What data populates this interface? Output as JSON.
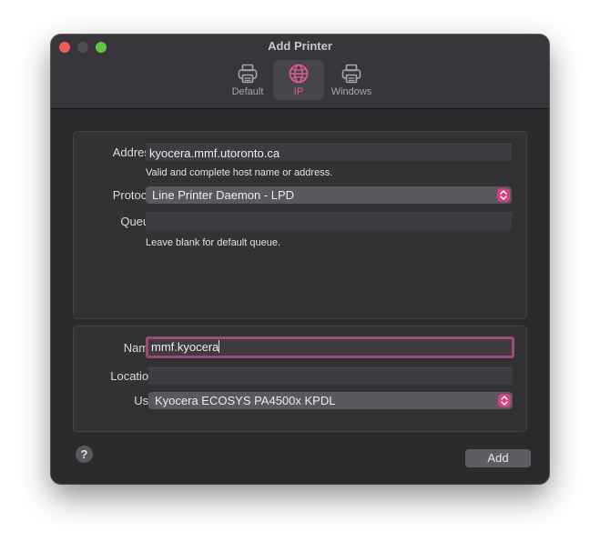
{
  "window": {
    "title": "Add Printer"
  },
  "tabs": [
    {
      "label": "Default",
      "icon": "printer-icon",
      "active": false
    },
    {
      "label": "IP",
      "icon": "globe-icon",
      "active": true
    },
    {
      "label": "Windows",
      "icon": "windows-printer-icon",
      "active": false
    }
  ],
  "colors": {
    "accent": "#e05a9a",
    "window_bg": "#2b2a2d",
    "stepper": "#d0437f",
    "focus_ring": "#9c4b78"
  },
  "connection": {
    "address_label": "Address:",
    "address_value": "kyocera.mmf.utoronto.ca",
    "address_hint": "Valid and complete host name or address.",
    "protocol_label": "Protocol:",
    "protocol_value": "Line Printer Daemon - LPD",
    "queue_label": "Queue:",
    "queue_value": "",
    "queue_hint": "Leave blank for default queue."
  },
  "details": {
    "name_label": "Name:",
    "name_value": "mmf.kyocera",
    "location_label": "Location:",
    "location_value": "",
    "use_label": "Use:",
    "use_value": "Kyocera ECOSYS PA4500x KPDL"
  },
  "footer": {
    "help_label": "?",
    "add_label": "Add"
  }
}
